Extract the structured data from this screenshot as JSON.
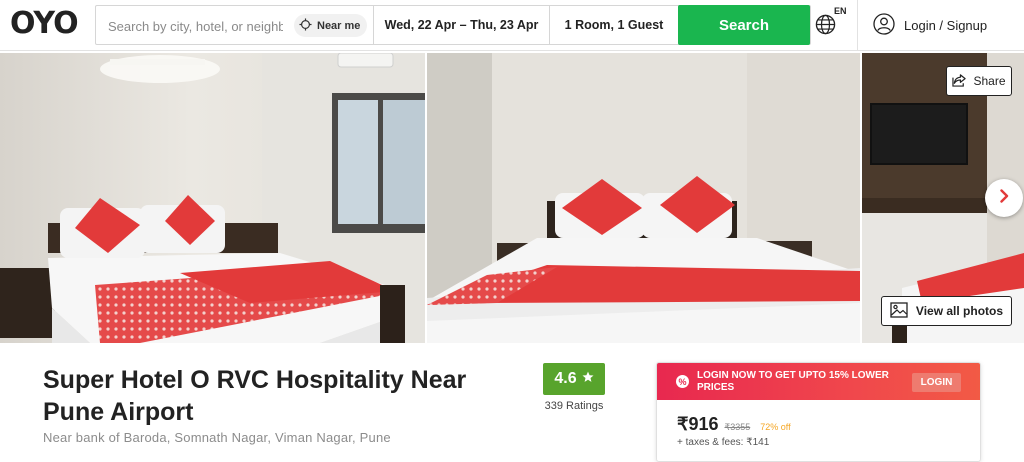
{
  "brand": {
    "logo_text": "OYO"
  },
  "search": {
    "placeholder": "Search by city, hotel, or neighbourhood",
    "near_me_label": "Near me",
    "dates": "Wed, 22 Apr – Thu, 23 Apr",
    "rooms_guests": "1 Room, 1 Guest",
    "button_label": "Search"
  },
  "header": {
    "language_code": "EN",
    "login_label": "Login / Signup"
  },
  "gallery": {
    "share_label": "Share",
    "view_all_label": "View all photos"
  },
  "hotel": {
    "name": "Super Hotel O RVC Hospitality Near Pune Airport",
    "address": "Near bank of Baroda, Somnath Nagar, Viman Nagar, Pune",
    "rating": "4.6",
    "rating_count": "339 Ratings"
  },
  "booking": {
    "promo_icon": "%",
    "promo_text": "LOGIN NOW TO GET UPTO 15% LOWER PRICES",
    "promo_login": "LOGIN",
    "price": "₹916",
    "original_price": "₹3355",
    "discount": "72% off",
    "taxes": "+ taxes & fees: ₹141"
  },
  "colors": {
    "primary_green": "#1ab64f",
    "rating_green": "#58a42c",
    "promo_red": "#e8284f",
    "discount_orange": "#f5a623",
    "pillow_red": "#e23a3a"
  }
}
